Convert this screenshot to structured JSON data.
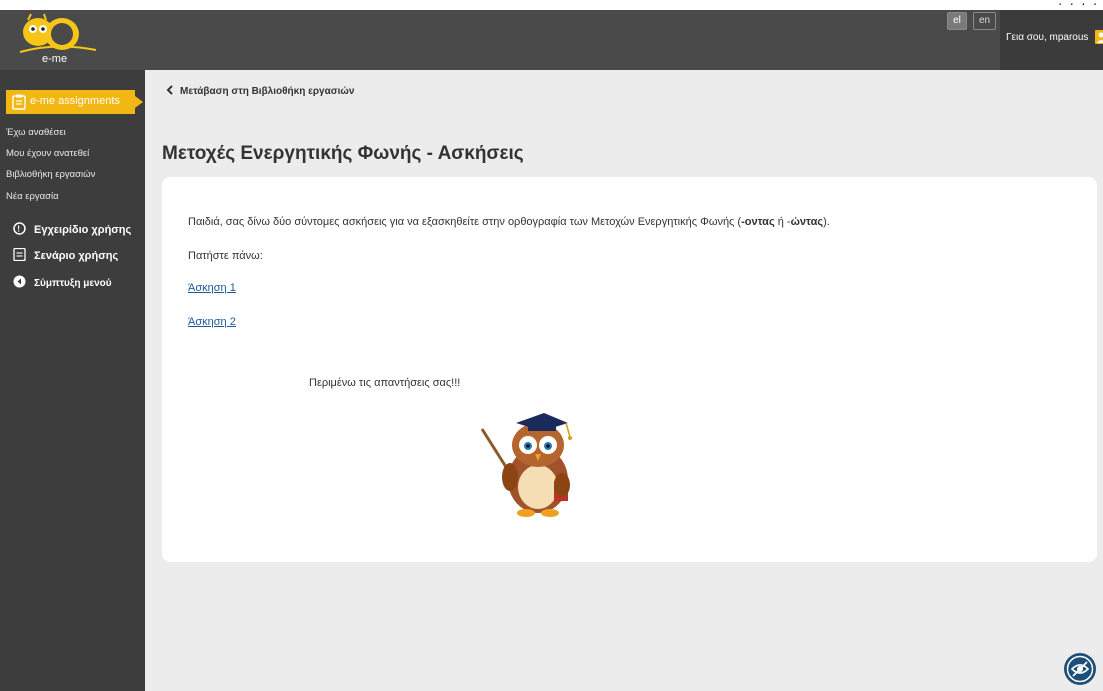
{
  "header": {
    "logo_text": "e-me",
    "lang_el": "el",
    "lang_en": "en",
    "greeting": "Γεια σου, mparous",
    "top_dots": "‧ ‧ ‧ ‧"
  },
  "sidebar": {
    "active": "e-me assignments",
    "sub_items": [
      "Έχω αναθέσει",
      "Μου έχουν ανατεθεί",
      "Βιβλιοθήκη εργασιών",
      "Νέα εργασία"
    ],
    "items": [
      {
        "label": "Εγχειρίδιο χρήσης",
        "icon": "help-icon"
      },
      {
        "label": "Σενάριο χρήσης",
        "icon": "document-icon"
      },
      {
        "label": "Σύμπτυξη μενού",
        "icon": "collapse-icon"
      }
    ]
  },
  "main": {
    "back_label": "Μετάβαση στη Βιβλιοθήκη εργασιών",
    "title": "Μετοχές Ενεργητικής Φωνής - Ασκήσεις",
    "intro_pre": "Παιδιά, σας δίνω δύο σύντομες ασκήσεις για να εξασκηθείτε στην ορθογραφία των Μετοχών Ενεργητικής Φωνής (",
    "intro_b1": "-οντας",
    "intro_mid": " ή -",
    "intro_b2": "ώντας",
    "intro_post": ").",
    "press_label": "Πατήστε πάνω:",
    "links": [
      "Άσκηση 1 ",
      "Άσκηση 2 "
    ],
    "wait_text": "Περιμένω τις απαντήσεις σας!!!",
    "image": "owl-teacher-image"
  },
  "colors": {
    "header": "#4a4a4a",
    "sidebar": "#3d3d3d",
    "accent": "#f2b712",
    "link": "#1a5a9a",
    "background": "#ececec"
  }
}
